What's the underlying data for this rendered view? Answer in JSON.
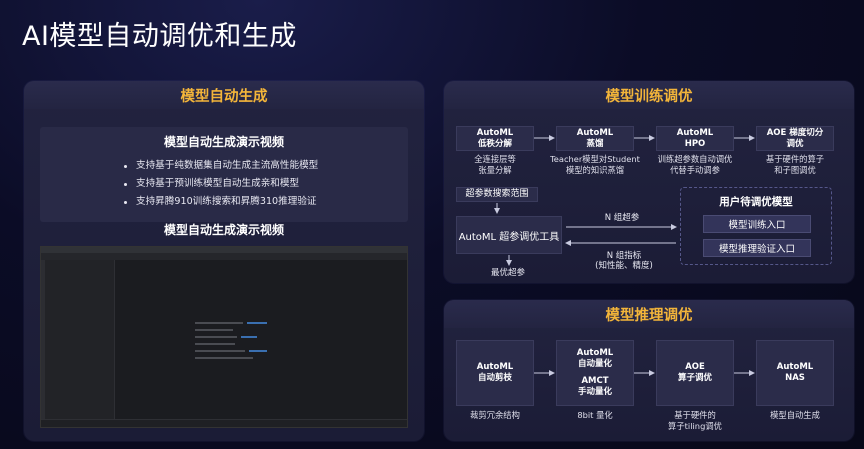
{
  "page": {
    "title": "AI模型自动调优和生成"
  },
  "left": {
    "title": "模型自动生成",
    "demo_title": "模型自动生成演示视频",
    "bullets": [
      "支持基于纯数据集自动生成主流高性能模型",
      "支持基于预训练模型自动生成亲和模型",
      "支持昇腾910训练搜索和昇腾310推理验证"
    ],
    "video_title": "模型自动生成演示视频"
  },
  "train": {
    "title": "模型训练调优",
    "top_nodes": [
      {
        "line1": "AutoML",
        "line2": "低秩分解",
        "cap1": "全连接层等",
        "cap2": "张量分解"
      },
      {
        "line1": "AutoML",
        "line2": "蒸馏",
        "cap1": "Teacher模型对Student",
        "cap2": "模型的知识蒸馏"
      },
      {
        "line1": "AutoML",
        "line2": "HPO",
        "cap1": "训练超参数自动调优",
        "cap2": "代替手动调参"
      },
      {
        "line1": "AOE 梯度切分",
        "line2": "调优",
        "cap1": "基于硬件的算子",
        "cap2": "和子图调优"
      }
    ],
    "search_range": "超参数搜索范围",
    "tool": "AutoML 超参调优工具",
    "best": "最优超参",
    "arrow_top": "N 组超参",
    "arrow_bottom1": "N 组指标",
    "arrow_bottom2": "(知性能、精度)",
    "user_title": "用户待调优模型",
    "user_btn1": "模型训练入口",
    "user_btn2": "模型推理验证入口"
  },
  "infer": {
    "title": "模型推理调优",
    "nodes": [
      {
        "lines": [
          "AutoML",
          "自动剪枝"
        ],
        "cap1": "裁剪冗余结构",
        "cap2": ""
      },
      {
        "lines": [
          "AutoML",
          "自动量化",
          "",
          "AMCT",
          "手动量化"
        ],
        "cap1": "8bit 量化",
        "cap2": ""
      },
      {
        "lines": [
          "AOE",
          "算子调优"
        ],
        "cap1": "基于硬件的",
        "cap2": "算子tiling调优"
      },
      {
        "lines": [
          "AutoML",
          "NAS"
        ],
        "cap1": "模型自动生成",
        "cap2": ""
      }
    ]
  },
  "colors": {
    "accent": "#f3b53a",
    "panel": "#22233f",
    "node": "#2b2c4a"
  }
}
